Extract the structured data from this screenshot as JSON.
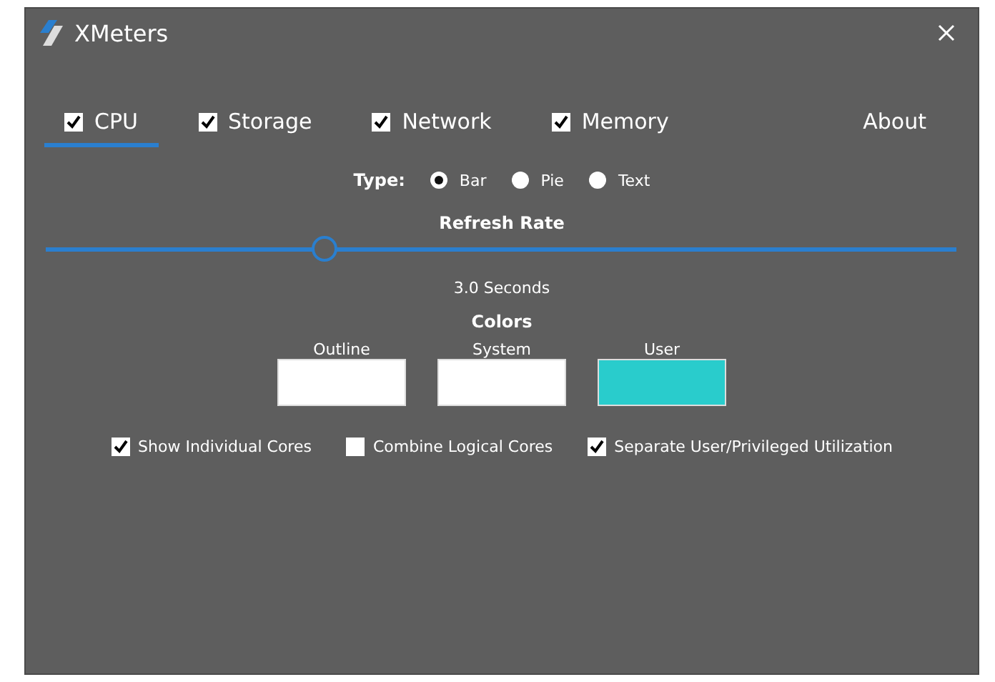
{
  "window": {
    "title": "XMeters"
  },
  "tabs": [
    {
      "label": "CPU",
      "checked": true,
      "selected": true
    },
    {
      "label": "Storage",
      "checked": true,
      "selected": false
    },
    {
      "label": "Network",
      "checked": true,
      "selected": false
    },
    {
      "label": "Memory",
      "checked": true,
      "selected": false
    }
  ],
  "about": "About",
  "type": {
    "label": "Type:",
    "options": [
      {
        "label": "Bar",
        "selected": true
      },
      {
        "label": "Pie",
        "selected": false
      },
      {
        "label": "Text",
        "selected": false
      }
    ]
  },
  "refresh": {
    "label": "Refresh Rate",
    "level": 0.3,
    "reading": "3.0 Seconds"
  },
  "colors": {
    "label": "Colors",
    "swatches": [
      {
        "label": "Outline",
        "color": "#ffffff"
      },
      {
        "label": "System",
        "color": "#ffffff"
      },
      {
        "label": "User",
        "color": "#29cccc"
      }
    ]
  },
  "options": [
    {
      "label": "Show Individual Cores",
      "checked": true
    },
    {
      "label": "Combine Logical Cores",
      "checked": false
    },
    {
      "label": "Separate User/Privileged Utilization",
      "checked": true
    }
  ]
}
